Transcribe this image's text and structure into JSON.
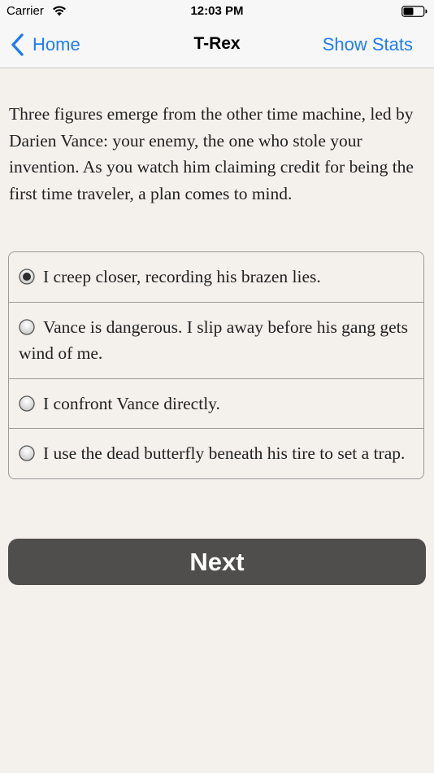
{
  "status_bar": {
    "carrier": "Carrier",
    "time": "12:03 PM"
  },
  "nav": {
    "back_label": "Home",
    "title": "T-Rex",
    "right_label": "Show Stats",
    "accent_color": "#1f7cf4"
  },
  "story": {
    "text": "Three figures emerge from the other time machine, led by Darien Vance: your enemy, the one who stole your invention. As you watch him claiming credit for being the first time traveler, a plan comes to mind."
  },
  "choices": [
    {
      "label": "I creep closer, recording his brazen lies.",
      "selected": true
    },
    {
      "label": "Vance is dangerous. I slip away before his gang gets wind of me.",
      "selected": false
    },
    {
      "label": "I confront Vance directly.",
      "selected": false
    },
    {
      "label": "I use the dead butterfly beneath his tire to set a trap.",
      "selected": false
    }
  ],
  "next_button": {
    "label": "Next",
    "background": "#4f4e4c"
  }
}
